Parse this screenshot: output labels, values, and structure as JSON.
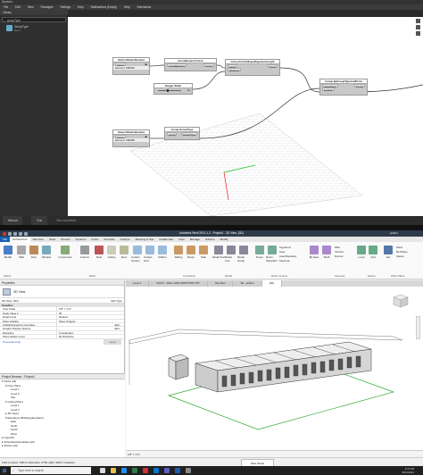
{
  "dynamo": {
    "title": "Dynamo",
    "menu": [
      "File",
      "Edit",
      "View",
      "Packages",
      "Settings",
      "Help",
      "Notifications (Empty)",
      "Help",
      "Extensions"
    ],
    "library": {
      "header": "Library",
      "search_value": "groupType",
      "result_name": "GroupType",
      "result_sub": "Bend"
    },
    "nodes": [
      {
        "title": "Select Model Element",
        "button": "Select",
        "info": "Element: 586453"
      },
      {
        "title": "CurveElement.Curve",
        "in": "curveElement",
        "out": "Curve"
      },
      {
        "title": "Curve.PointAtEqualSegmentLength",
        "in1": "curve",
        "in2": "divisions",
        "out": "Point"
      },
      {
        "title": "Integer Slider",
        "value": "10"
      },
      {
        "title": "Group.ByGroupTypeAndPoint",
        "in1": "groupType",
        "in2": "location",
        "out": "Group"
      },
      {
        "title": "Select Model Element",
        "button": "Select",
        "info": "Element: 586458"
      },
      {
        "title": "Group.GroupType",
        "in": "group",
        "out": "GroupType"
      }
    ],
    "status": {
      "run_mode": "Manual",
      "run": "Run",
      "message": "Run completed."
    }
  },
  "revit": {
    "title": "Autodesk Revit 2021.1.2 - Project1 - 3D View: {3D}",
    "user": "pcdtmr",
    "menu_tabs": [
      "File",
      "Architecture",
      "Structure",
      "Steel",
      "Precast",
      "Systems",
      "Insert",
      "Annotate",
      "Analyze",
      "Massing & Site",
      "Collaborate",
      "View",
      "Manage",
      "Add-Ins",
      "Modify"
    ],
    "ribbon_buttons": [
      "Modify",
      "Wall",
      "Door",
      "Window",
      "Component",
      "Column",
      "Roof",
      "Ceiling",
      "Floor",
      "Curtain System",
      "Curtain Grid",
      "Mullion",
      "Railing",
      "Ramp",
      "Stair",
      "Model Text",
      "Model Line",
      "Model Group",
      "Room",
      "Room Separator",
      "Tag Room",
      "Area",
      "Area Boundary",
      "Tag Area",
      "By Face",
      "Shaft",
      "Wall",
      "Vertical",
      "Dormer",
      "Level",
      "Grid",
      "Set",
      "Show",
      "Ref Plane",
      "Viewer"
    ],
    "panels": [
      "Select",
      "Build",
      "Circulation",
      "Model",
      "Room & Area",
      "Opening",
      "Datum",
      "Work Plane"
    ],
    "properties": {
      "header": "Properties",
      "type_name": "3D View",
      "view_label": "3D View: {3D}",
      "edit_type": "Edit Type",
      "groups": [
        {
          "name": "Graphics",
          "rows": [
            [
              "View Scale",
              "1/8\" = 1'-0\""
            ],
            [
              "Scale Value 1:",
              "96"
            ],
            [
              "Detail Level",
              "Medium"
            ],
            [
              "Parts Visibility",
              "Show Original"
            ],
            [
              "Visibility/Graphics Overrides",
              "Edit..."
            ],
            [
              "Graphic Display Options",
              "Edit..."
            ],
            [
              "Discipline",
              "Coordination"
            ],
            [
              "Show Hidden Lines",
              "By Discipline"
            ]
          ]
        }
      ],
      "help": "Properties help",
      "apply": "Apply"
    },
    "browser": {
      "header": "Project Browser - Project1",
      "items": [
        "Views (all)",
        "Floor Plans",
        "Level 1",
        "Level 2",
        "Site",
        "Ceiling Plans",
        "Level 1",
        "Level 2",
        "3D Views",
        "Elevations (Building Elevation)",
        "East",
        "North",
        "South",
        "West",
        "Legends",
        "Schedules/Quantities (all)",
        "Sheets (all)"
      ]
    },
    "view_tabs": [
      "Level 1",
      "VAULT - WALL AND PARTITION TYP.",
      "Site Plan",
      "3D - pcdtmr",
      "{3D}"
    ],
    "view_scale": "1/8\" = 1'-0\"",
    "status_bar": "Click to select, TAB for alternates, CTRL adds, SHIFT unselects.",
    "model_label": "Main Model"
  },
  "windows": {
    "search": "Type here to search",
    "time1": "9:47 AM",
    "date1": "10/11/2021",
    "time2": "9:47 AM",
    "date2": "10/11/2021"
  }
}
